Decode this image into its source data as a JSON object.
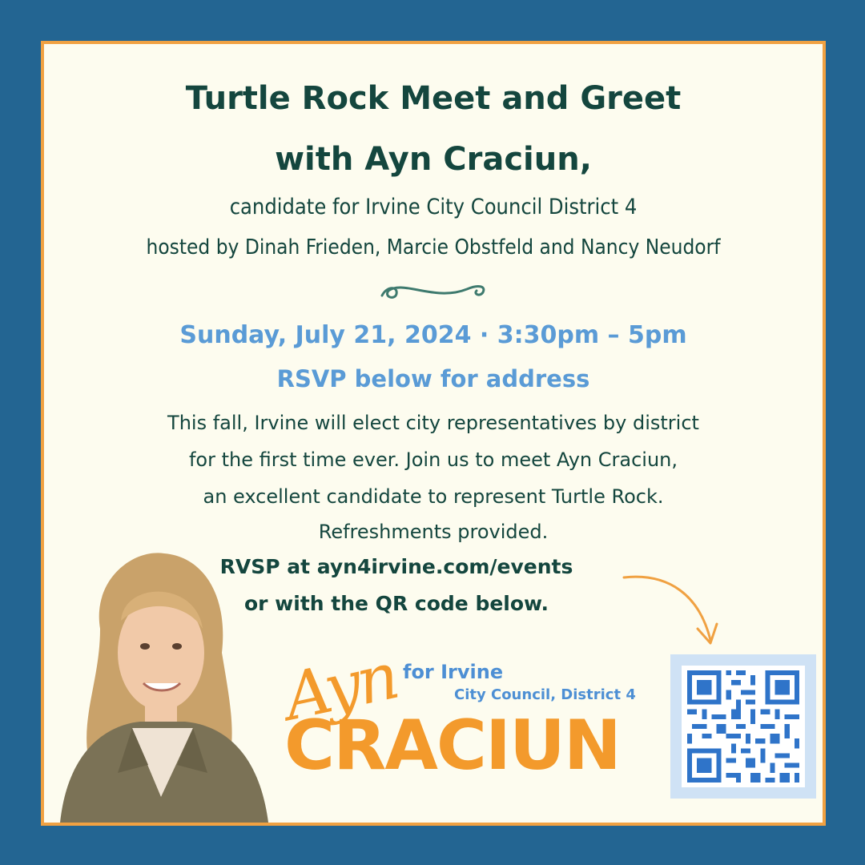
{
  "title_line1": "Turtle Rock Meet and Greet",
  "title_line2": "with Ayn Craciun,",
  "subtitle_line1": "candidate for Irvine City Council District 4",
  "subtitle_line2": "hosted by Dinah Frieden, Marcie Obstfeld and Nancy Neudorf",
  "date_time": "Sunday, July 21, 2024 · 3:30pm – 5pm",
  "rsvp_address": "RSVP below for address",
  "description_lines": [
    "This fall, Irvine will elect city representatives by district",
    "for the first time ever. Join us to meet Ayn Craciun,",
    "an excellent candidate to represent Turtle Rock.",
    "Refreshments provided."
  ],
  "rsvp_line1": "RVSP at ayn4irvine.com/events",
  "rsvp_line2": "or with the QR code below.",
  "logo": {
    "script_name": "Ayn",
    "for_text": "for Irvine",
    "council_text": "City Council, District 4",
    "surname": "CRACIUN"
  },
  "colors": {
    "background": "#236592",
    "card": "#fdfcef",
    "border": "#f0a142",
    "heading": "#14463e",
    "accent_blue": "#5a9bd6",
    "accent_orange": "#f39a2c"
  }
}
